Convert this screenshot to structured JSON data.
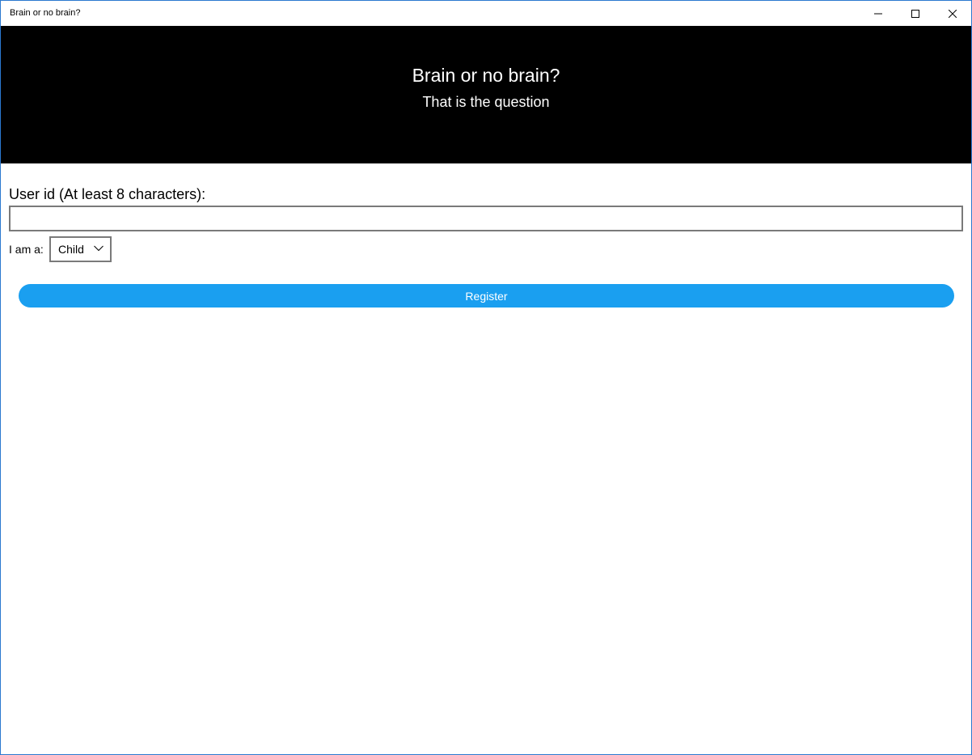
{
  "window": {
    "title": "Brain or no brain?"
  },
  "header": {
    "title": "Brain or no brain?",
    "subtitle": "That is the question"
  },
  "form": {
    "userid_label": "User id (At least 8 characters):",
    "userid_value": "",
    "role_label": "I am a:",
    "role_selected": "Child",
    "register_label": "Register"
  },
  "colors": {
    "header_bg": "#000000",
    "button_bg": "#1a9ff0",
    "window_border": "#2b79d0"
  },
  "icons": {
    "minimize": "minimize-icon",
    "maximize": "maximize-icon",
    "close": "close-icon",
    "dropdown": "chevron-down-icon"
  }
}
